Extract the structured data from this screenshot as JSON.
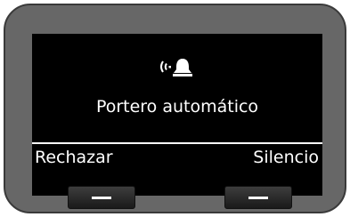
{
  "screen": {
    "status_icon": "incoming-ring-icon",
    "caller_label": "Portero automático"
  },
  "softkeys": {
    "left_label": "Rechazar",
    "right_label": "Silencio"
  },
  "hardware_keys": {
    "left_icon": "dash-icon",
    "right_icon": "dash-icon"
  },
  "colors": {
    "screen_background": "#000000",
    "screen_text": "#ffffff",
    "device_body": "#676767"
  }
}
